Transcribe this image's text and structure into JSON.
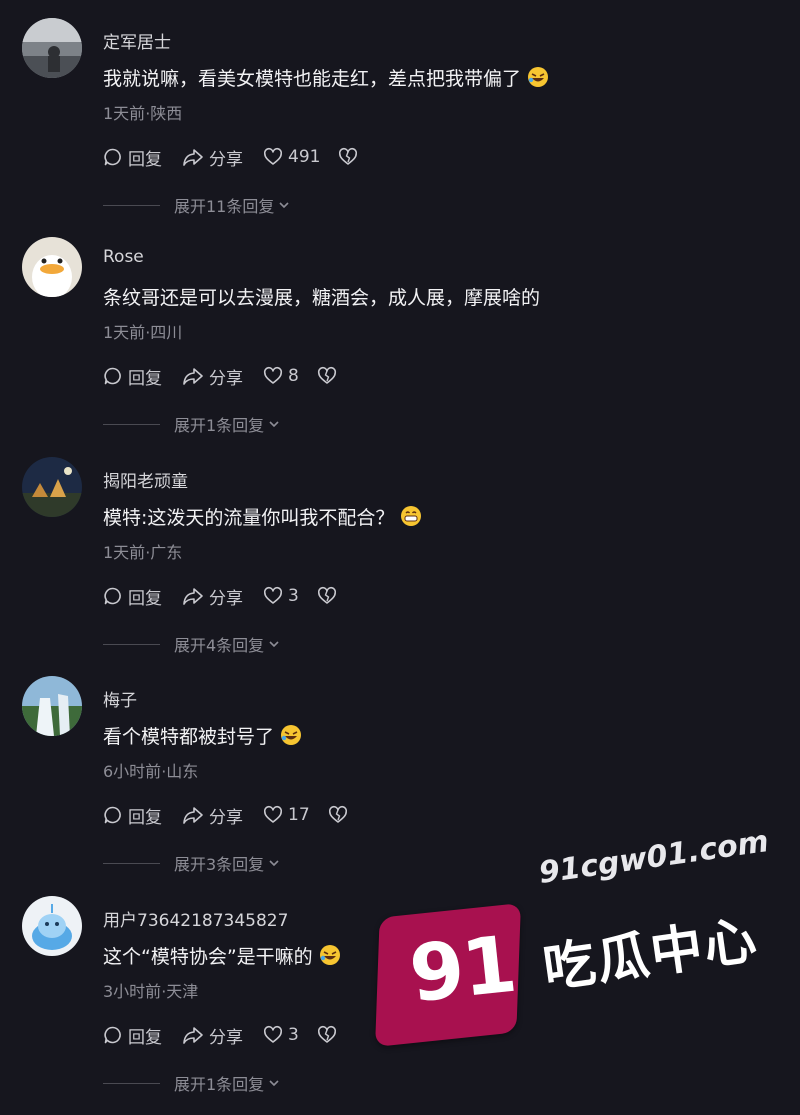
{
  "comments": [
    {
      "username": "定军居士",
      "text": "我就说嘛，看美女模特也能走红，差点把我带偏了",
      "emoji": "rofl-emoji",
      "time": "1天前",
      "location": "陕西",
      "reply_label": "回复",
      "share_label": "分享",
      "likes": "491",
      "expand_label": "展开11条回复"
    },
    {
      "username": "Rose",
      "text": "条纹哥还是可以去漫展，糖酒会，成人展，摩展啥的",
      "emoji": "",
      "time": "1天前",
      "location": "四川",
      "reply_label": "回复",
      "share_label": "分享",
      "likes": "8",
      "expand_label": "展开1条回复"
    },
    {
      "username": "揭阳老顽童",
      "text": "模特:这泼天的流量你叫我不配合？",
      "emoji": "grin-emoji",
      "time": "1天前",
      "location": "广东",
      "reply_label": "回复",
      "share_label": "分享",
      "likes": "3",
      "expand_label": "展开4条回复"
    },
    {
      "username": "梅子",
      "text": "看个模特都被封号了",
      "emoji": "rofl-emoji",
      "time": "6小时前",
      "location": "山东",
      "reply_label": "回复",
      "share_label": "分享",
      "likes": "17",
      "expand_label": "展开3条回复"
    },
    {
      "username": "用户73642187345827",
      "text": "这个“模特协会”是干嘛的",
      "emoji": "rofl-emoji",
      "time": "3小时前",
      "location": "天津",
      "reply_label": "回复",
      "share_label": "分享",
      "likes": "3",
      "expand_label": "展开1条回复"
    }
  ],
  "meta_separator": "·",
  "watermark": {
    "number": "91",
    "url": "91cgw01.com",
    "name": "吃瓜中心",
    "badge_color": "#a8114f"
  },
  "colors": {
    "background": "#16161e",
    "text_primary": "#f2f2f4",
    "text_secondary": "#8d8d96"
  }
}
